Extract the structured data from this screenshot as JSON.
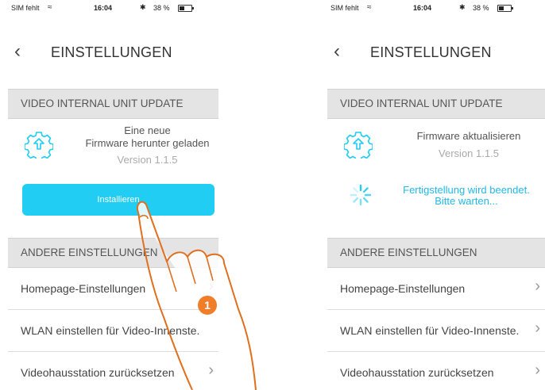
{
  "screens": [
    {
      "status": {
        "carrier": "SIM fehlt",
        "time": "16:04",
        "battery": "38 %"
      },
      "title": "EINSTELLUNGEN",
      "section1": "VIDEO INTERNAL UNIT UPDATE",
      "fw_line1": "Eine neue",
      "fw_line2": "Firmware herunter geladen",
      "version": "Version 1.1.5",
      "install_label": "Installieren",
      "section2": "ANDERE EINSTELLUNGEN",
      "items": [
        "Homepage-Einstellungen",
        "WLAN einstellen für Video-Innenste.",
        "Videohausstation zurücksetzen"
      ]
    },
    {
      "status": {
        "carrier": "SIM fehlt",
        "time": "16:04",
        "battery": "38 %"
      },
      "title": "EINSTELLUNGEN",
      "section1": "VIDEO INTERNAL UNIT UPDATE",
      "fw_line1": "Firmware aktualisieren",
      "version": "Version 1.1.5",
      "finishing1": "Fertigstellung wird beendet.",
      "finishing2": "Bitte warten...",
      "section2": "ANDERE EINSTELLUNGEN",
      "items": [
        "Homepage-Einstellungen",
        "WLAN einstellen für Video-Innenste.",
        "Videohausstation zurücksetzen"
      ]
    }
  ],
  "step_number": "1",
  "accent_color": "#21cdf3",
  "step_color": "#f07e28"
}
